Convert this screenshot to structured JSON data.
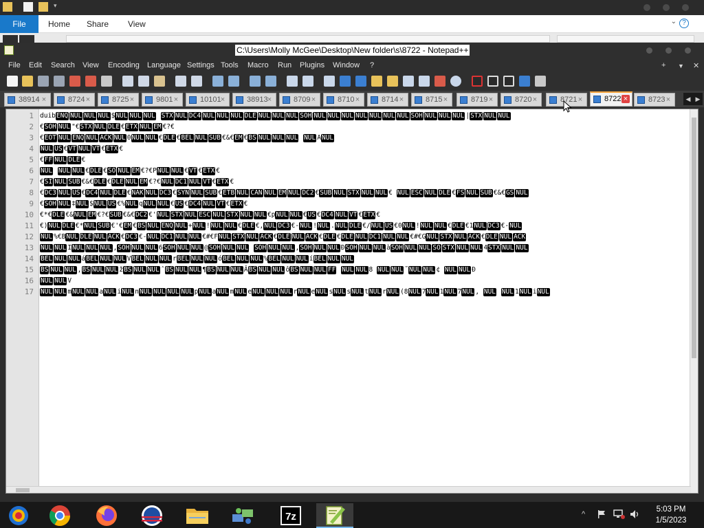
{
  "explorer": {
    "ribbon_tabs": {
      "file": "File",
      "home": "Home",
      "share": "Share",
      "view": "View"
    },
    "help_icon": "?"
  },
  "npp": {
    "title": "C:\\Users\\Molly McGee\\Desktop\\New folder\\s\\8722 - Notepad++",
    "menu": {
      "file": "File",
      "edit": "Edit",
      "search": "Search",
      "view": "View",
      "encoding": "Encoding",
      "language": "Language",
      "settings": "Settings",
      "tools": "Tools",
      "macro": "Macro",
      "run": "Run",
      "plugins": "Plugins",
      "window": "Window",
      "help": "?",
      "plus": "+",
      "dropdown": "▼",
      "close": "✕"
    },
    "tabs": [
      {
        "label": "38914"
      },
      {
        "label": "8724"
      },
      {
        "label": "8725"
      },
      {
        "label": "9801"
      },
      {
        "label": "10101"
      },
      {
        "label": "38913"
      },
      {
        "label": "8709"
      },
      {
        "label": "8710"
      },
      {
        "label": "8714"
      },
      {
        "label": "8715"
      },
      {
        "label": "8719"
      },
      {
        "label": "8720"
      },
      {
        "label": "8721"
      },
      {
        "label": "8722",
        "active": true
      },
      {
        "label": "8723"
      }
    ],
    "line_numbers": [
      "1",
      "2",
      "3",
      "4",
      "5",
      "6",
      "7",
      "8",
      "9",
      "10",
      "11",
      "12",
      "13",
      "14",
      "15",
      "16",
      "17"
    ],
    "lines": [
      "duib[ENQ][NUL][NUL][NUL]$[NUL][NUL][NUL] [STX][NUL][DC4][NUL][NUL][NUL][DLE][NUL][NUL][NUL][SOH][NUL][NUL][NUL][NUL][NUL][NUL][NUL][SOH][NUL][NUL][NUL]|[STX][NUL][NUL]",
      "€[SOH][NUL]\"€[STX][NUL][DLE]€[ETX][NUL][EM]€?€",
      "€[EOT][NUL][ENQ][NUL][ACK][NUL]0[NUL][NUL]€[DLE]€[BEL][NUL][SUB]€&€[EM]€[BS][NUL][NUL][NUL] [NUL]A[NUL]",
      "[NUL][US]€[VT][NUL][VT]€[ETX]€",
      "€[FF][NUL][DLE]€",
      "[NUL] [NUL][NUL]€[DLE]€[SO][NUL][EM]€?€P[NUL][NUL]€[VT]€[ETX]€",
      "€[SI][NUL][SUB]€&€[DLE]€[DLE][NUL][EM]€?€[NUL][DC1][NUL][VT]€[ETX]€",
      "€[DC3][NUL][US]€[DC4][NUL][DLE]€[NAK][NUL][DC3]€[SYN][NUL][SUB]€[ETB][NUL][CAN][NUL][EM][NUL][DC2]€[SUB][NUL][STX][NUL][NUL]€ [NUL][ESC][NUL][DLE]€[FS][NUL][SUB]€&€[GS][NUL]",
      "€[SOH][NUL]‡[NUL]$[NUL][US]€%[NUL]q[NUL][NUL]€[US]€[DC4][NUL][VT]€[ETX]€",
      "€*€[DLE]€&[NUL][EM]€?€[SUB]€&€[DC2]€'[NUL][STX][NUL][ESC][NUL][STX][NUL][NUL]€p[NUL][NUL]€[US]€[DC4][NUL][VT]€[ETX]€",
      "€)[NUL][DLE]€*[NUL][SUB]€'€[EM]€[BS][NUL][ENQ][NUL]+[NUL]![NUL][NUL]€[DLE]€,[NUL][DC3]€-[NUL]![NUL].[NUL][DLE]€/[NUL][US]€0[NUL]![NUL][NUL]€[DLE]€1[NUL][DC3]€-[NUL]",
      "[NUL]%€B[NUL][DLE][NUL][ACK]€[DC3]€-[NUL][DC1][NUL][NUL]€#€F[NUL][STX][NUL][ACK]€[DLE][NUL][ACK]€[DLE]€[DLE][NUL][DC1][NUL][NUL]€#€G[NUL][STX][NUL][ACK]€[DLE][NUL][ACK]",
      "[NUL][NUL]I[NUL][NUL][NUL],[SOH][NUL][NUL]6[SOH][NUL][NUL]@[SOH][NUL][NUL] [SOH][NUL][NUL],[SOH][NUL][NUL]Ð[SOH][NUL][NUL]à[SOH][NUL][NUL][SO][STX][NUL][NUL]4[STX][NUL][NUL]",
      "[BEL][NUL][NUL]á[BEL][NUL][NUL]V[BEL][NUL][NUL]r[BEL][NUL][NUL]ó[BEL][NUL][NUL]%[BEL][NUL][NUL]í[BEL][NUL][NUL]",
      "[BS][NUL][NUL],[BS][NUL][NUL]ž[BS][NUL][NUL]ˆ[BS][NUL][NUL]¶[BS][NUL][NUL]Â[BS][NUL][NUL]ô[BS][NUL][NUL][FF]    [NUL][NUL]8     [NUL][NUL]˜[NUL][NUL]¢     [NUL][NUL]Ð",
      "[NUL][NUL]V",
      "[NUL][NUL]m[NUL][NUL]a[NUL]i[NUL]n[NUL][NUL][NUL][NUL]p[NUL]a[NUL]m[NUL]e[NUL][NUL][NUL]r[NUL]e[NUL]s[NUL]s[NUL]t[NUL]r[NUL](8[NUL]7[NUL]1[NUL]7[NUL], [NUL] [NUL]1[NUL]i[NUL]"
    ]
  },
  "taskbar": {
    "apps": [
      "start-icon",
      "chrome-icon",
      "firefox-icon",
      "obama-logo-icon",
      "file-explorer-icon",
      "network-app-icon",
      "7zip-icon",
      "notepadpp-icon"
    ],
    "sevenzip_label": "7z",
    "show_hidden": "^",
    "time": "5:03 PM",
    "date": "1/5/2023"
  }
}
